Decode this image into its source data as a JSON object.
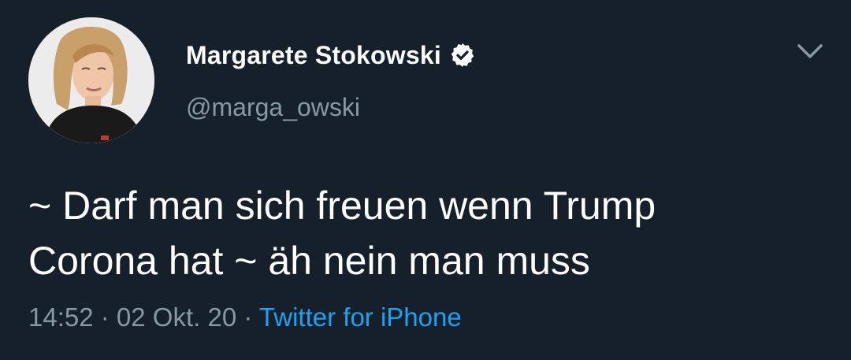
{
  "author": {
    "display_name": "Margarete Stokowski",
    "handle": "@marga_owski",
    "verified_icon": "verified-badge-icon",
    "avatar_icon": "avatar-photo"
  },
  "tweet": {
    "line1": "~ Darf man sich freuen wenn Trump",
    "line2": "Corona hat ~ äh nein man muss"
  },
  "meta": {
    "time": "14:52",
    "separator1": " · ",
    "date": "02 Okt. 20",
    "separator2": " · ",
    "source": "Twitter for iPhone"
  },
  "controls": {
    "more_icon": "chevron-down-icon"
  },
  "colors": {
    "background": "#15202b",
    "primary_text": "#ffffff",
    "secondary_text": "#8899a6",
    "link": "#1da1f2"
  }
}
